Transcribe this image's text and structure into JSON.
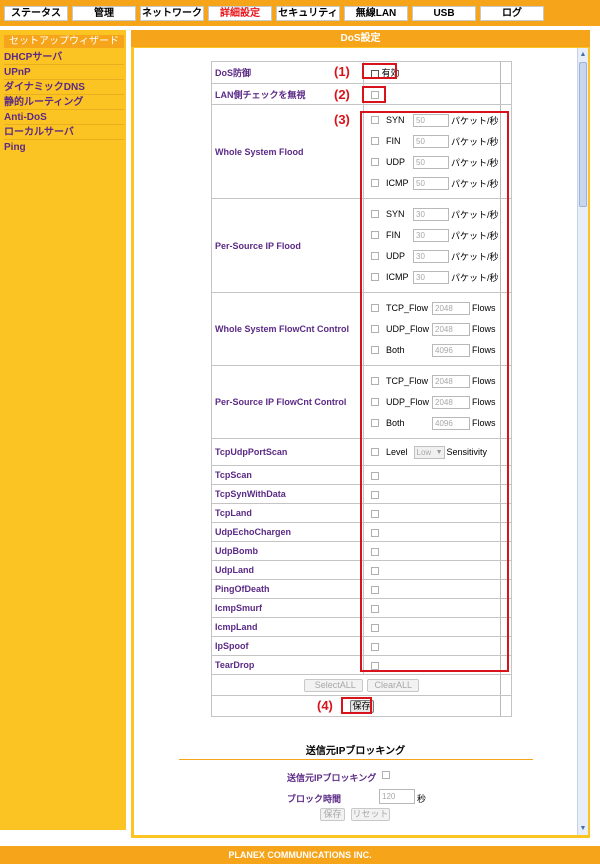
{
  "nav": {
    "tabs": [
      {
        "label": "ステータス",
        "active": false
      },
      {
        "label": "管理",
        "active": false
      },
      {
        "label": "ネットワーク",
        "active": false
      },
      {
        "label": "詳細設定",
        "active": true
      },
      {
        "label": "セキュリティ",
        "active": false
      },
      {
        "label": "無線LAN",
        "active": false
      },
      {
        "label": "USB",
        "active": false
      },
      {
        "label": "ログ",
        "active": false
      }
    ]
  },
  "sidebar": {
    "header": "セットアップウィザード",
    "items": [
      "DHCPサーバ",
      "UPnP",
      "ダイナミックDNS",
      "静的ルーティング",
      "Anti-DoS",
      "ローカルサーバ",
      "Ping"
    ]
  },
  "main": {
    "title": "DoS設定"
  },
  "dos": {
    "enable_label": "DoS防御",
    "enable_text": "有効",
    "lan_check_label": "LAN側チェックを無視",
    "whole_flood": {
      "label": "Whole System Flood",
      "rows": [
        {
          "name": "SYN",
          "value": "50",
          "unit": "パケット/秒"
        },
        {
          "name": "FIN",
          "value": "50",
          "unit": "パケット/秒"
        },
        {
          "name": "UDP",
          "value": "50",
          "unit": "パケット/秒"
        },
        {
          "name": "ICMP",
          "value": "50",
          "unit": "パケット/秒"
        }
      ]
    },
    "per_source_flood": {
      "label": "Per-Source IP Flood",
      "rows": [
        {
          "name": "SYN",
          "value": "30",
          "unit": "パケット/秒"
        },
        {
          "name": "FIN",
          "value": "30",
          "unit": "パケット/秒"
        },
        {
          "name": "UDP",
          "value": "30",
          "unit": "パケット/秒"
        },
        {
          "name": "ICMP",
          "value": "30",
          "unit": "パケット/秒"
        }
      ]
    },
    "whole_flowcnt": {
      "label": "Whole System FlowCnt Control",
      "rows": [
        {
          "name": "TCP_Flow",
          "value": "2048",
          "unit": "Flows"
        },
        {
          "name": "UDP_Flow",
          "value": "2048",
          "unit": "Flows"
        },
        {
          "name": "Both",
          "value": "4096",
          "unit": "Flows"
        }
      ]
    },
    "per_source_flowcnt": {
      "label": "Per-Source IP FlowCnt Control",
      "rows": [
        {
          "name": "TCP_Flow",
          "value": "2048",
          "unit": "Flows"
        },
        {
          "name": "UDP_Flow",
          "value": "2048",
          "unit": "Flows"
        },
        {
          "name": "Both",
          "value": "4096",
          "unit": "Flows"
        }
      ]
    },
    "portscan": {
      "label": "TcpUdpPortScan",
      "level_label": "Level",
      "level_value": "Low",
      "sensitivity_label": "Sensitivity"
    },
    "attacks": [
      "TcpScan",
      "TcpSynWithData",
      "TcpLand",
      "UdpEchoChargen",
      "UdpBomb",
      "UdpLand",
      "PingOfDeath",
      "IcmpSmurf",
      "IcmpLand",
      "IpSpoof",
      "TearDrop"
    ],
    "select_all": "SelectALL",
    "clear_all": "ClearALL",
    "save": "保存"
  },
  "callouts": {
    "c1": "(1)",
    "c2": "(2)",
    "c3": "(3)",
    "c4": "(4)"
  },
  "block": {
    "title": "送信元IPブロッキング",
    "enable_label": "送信元IPブロッキング",
    "time_label": "ブロック時間",
    "time_value": "120",
    "time_unit": "秒",
    "save": "保存",
    "reset": "リセット"
  },
  "footer": "PLANEX COMMUNICATIONS INC.",
  "colors": {
    "orange": "#f6a41a",
    "sidebar": "#fcc422",
    "label_purple": "#5b2a86",
    "annotation_red": "#d8131b",
    "active_tab_red": "#e8191e"
  }
}
